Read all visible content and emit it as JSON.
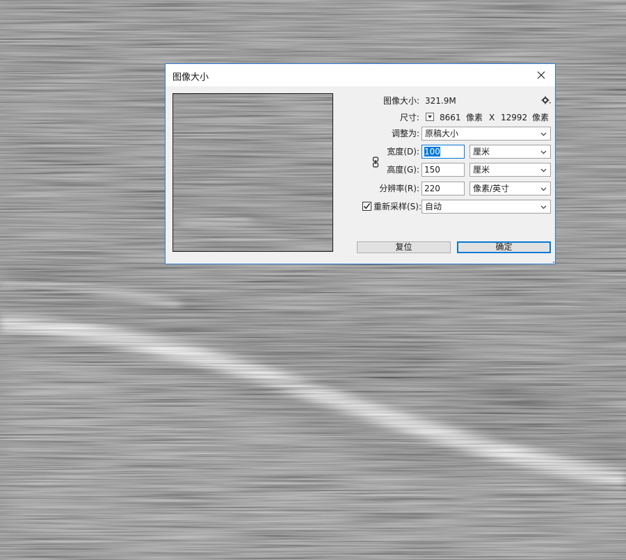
{
  "dialog": {
    "title": "图像大小",
    "image_size_label": "图像大小:",
    "image_size_value": "321.9M",
    "dimensions_label": "尺寸:",
    "dimensions_width": "8661",
    "dimensions_unit_1": "像素",
    "dimensions_x": "X",
    "dimensions_height": "12992",
    "dimensions_unit_2": "像素",
    "fit_label": "调整为:",
    "fit_value": "原稿大小",
    "width_label": "宽度(D):",
    "width_value": "100",
    "width_unit": "厘米",
    "height_label": "高度(G):",
    "height_value": "150",
    "height_unit": "厘米",
    "resolution_label": "分辨率(R):",
    "resolution_value": "220",
    "resolution_unit": "像素/英寸",
    "resample_label": "重新采样(S):",
    "resample_checked": true,
    "resample_value": "自动",
    "reset_button": "复位",
    "ok_button": "确定"
  },
  "icons": {
    "close": "close-icon",
    "gear": "gear-icon",
    "link": "link-icon",
    "dropdown": "chevron-down-icon",
    "checkmark": "checkmark-icon"
  },
  "colors": {
    "dialog_border": "#2b7bd6",
    "selection": "#0078d7",
    "dialog_bg": "#f0f0f0"
  }
}
